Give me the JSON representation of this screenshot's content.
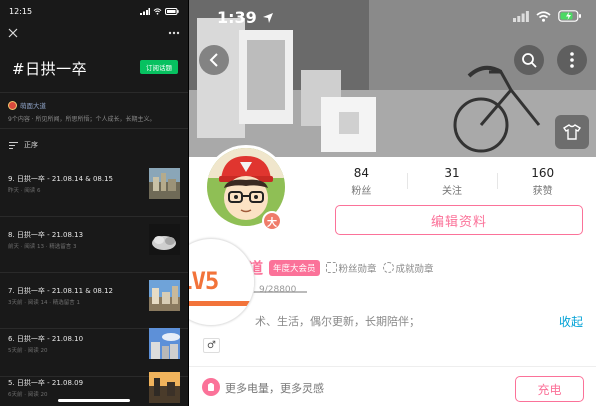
{
  "left": {
    "status": {
      "time": "12:15"
    },
    "title": "#日拱一卒",
    "subscribe_label": "订阅话题",
    "author": "萌面大道",
    "description": "9个内容 · 所见所闻，所思所悟；个人成长，长期主义。",
    "sort_label": "正序",
    "items": [
      {
        "title": "9. 日拱一卒 - 21.08.14 & 08.15",
        "meta": "昨天 · 阅读 6"
      },
      {
        "title": "8. 日拱一卒 - 21.08.13",
        "meta": "前天 · 阅读 13 · 精选留言 3"
      },
      {
        "title": "7. 日拱一卒 - 21.08.11 & 08.12",
        "meta": "3天前 · 阅读 14 · 精选留言 1"
      },
      {
        "title": "6. 日拱一卒 - 21.08.10",
        "meta": "5天前 · 阅读 20"
      },
      {
        "title": "5. 日拱一卒 - 21.08.09",
        "meta": "6天前 · 阅读 20"
      }
    ]
  },
  "right": {
    "status": {
      "time": "1:39"
    },
    "stats": [
      {
        "value": "84",
        "label": "粉丝"
      },
      {
        "value": "31",
        "label": "关注"
      },
      {
        "value": "160",
        "label": "获赞"
      }
    ],
    "edit_label": "编辑资料",
    "badge_char": "大",
    "username": "萌面大道",
    "vip_label": "年度大会员",
    "fan_medal": "粉丝勋章",
    "achievement": "成就勋章",
    "level": "LV5",
    "exp": "9/28800",
    "signature": "术、生活，偶尔更新，长期陪伴；",
    "collapse_label": "收起",
    "gender_symbol": "♂",
    "promo": "更多电量，更多灵感",
    "charge_label": "充电",
    "colors": {
      "brand": "#fb7299",
      "link": "#00a1d6",
      "wechat_green": "#07c160"
    }
  }
}
